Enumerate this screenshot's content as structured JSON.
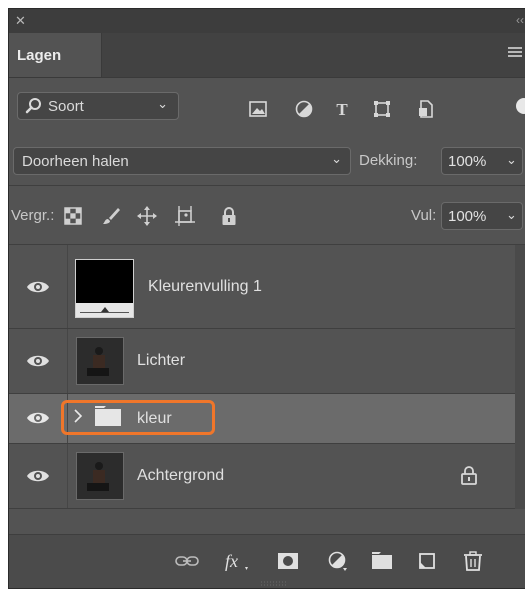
{
  "window": {
    "close_icon": "close-icon",
    "collapse_icon": "double-chevron-icon"
  },
  "panel": {
    "tab_label": "Lagen"
  },
  "filter": {
    "kind_label": "Soort"
  },
  "blend": {
    "mode_label": "Doorheen halen",
    "opacity_label": "Dekking:",
    "opacity_value": "100%"
  },
  "lock": {
    "label": "Vergr.:",
    "fill_label": "Vul:",
    "fill_value": "100%"
  },
  "layers": [
    {
      "name": "Kleurenvulling 1",
      "visible": true,
      "type": "fill"
    },
    {
      "name": "Lichter",
      "visible": true,
      "type": "image"
    },
    {
      "name": "kleur",
      "visible": true,
      "type": "group",
      "selected": true,
      "highlighted": true
    },
    {
      "name": "Achtergrond",
      "visible": true,
      "type": "image",
      "locked": true
    }
  ],
  "colors": {
    "panel_bg": "#535353",
    "selected_row": "#6b6b6b",
    "highlight": "#f0762a"
  }
}
